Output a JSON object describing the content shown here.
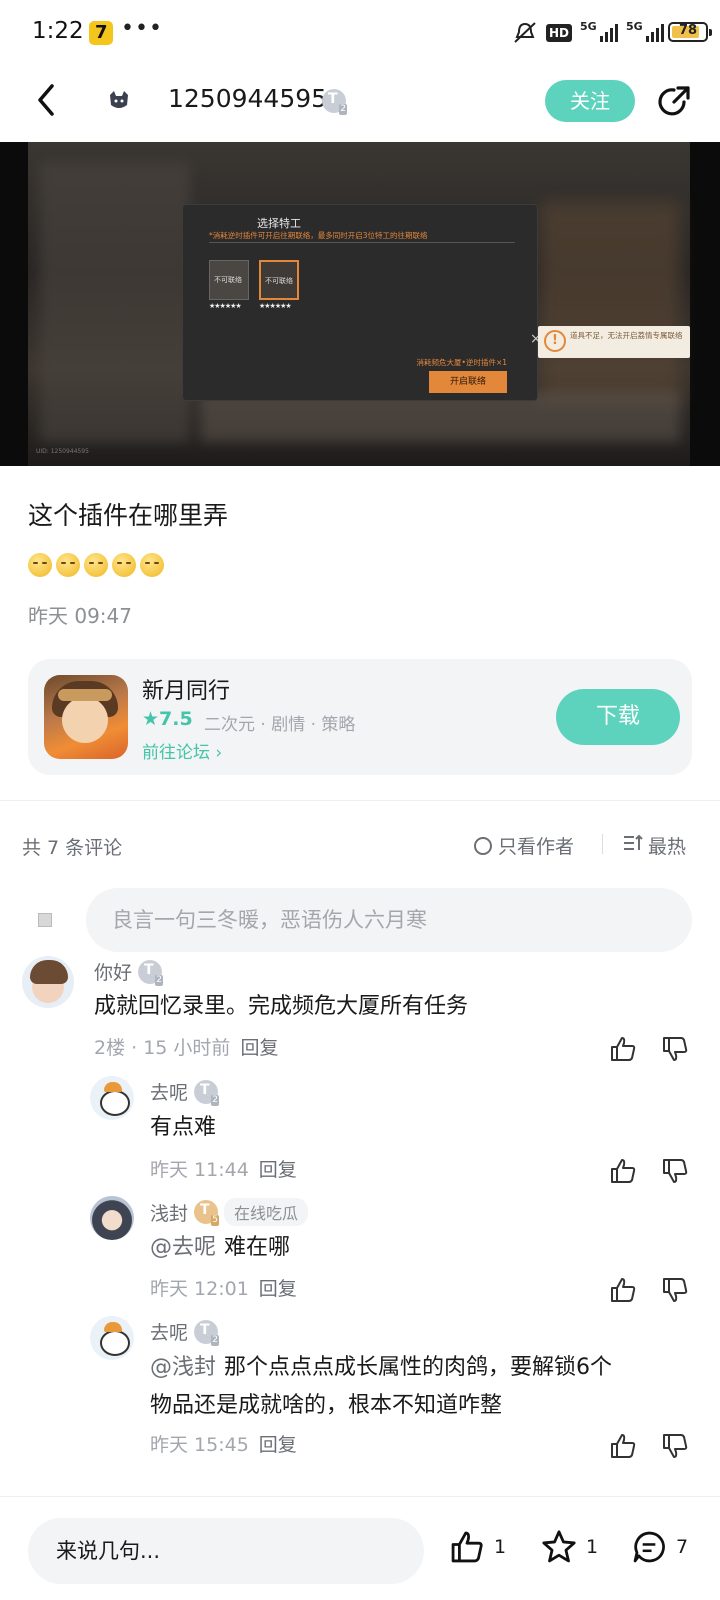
{
  "status": {
    "time": "1:22",
    "dots": "•••",
    "hd": "HD",
    "net1": "5G",
    "net2": "5G",
    "battery": "78"
  },
  "header": {
    "username": "1250944595",
    "follow_label": "关注"
  },
  "screenshot": {
    "dialog_title": "选择特工",
    "dialog_sub": "*消耗逆时插件可开启往期联络，最多同时开启3位特工的往期联络",
    "card_label_1": "不可联络",
    "card_label_2": "不可联络",
    "stars": "★★★★★★",
    "cost_text": "消耗频危大厦•逆时插件×1",
    "open_button": "开启联络",
    "toast_text": "道具不足，无法开启荔情专属联络",
    "toast_icon": "!",
    "uid": "UID: 1250944595"
  },
  "post": {
    "title": "这个插件在哪里弄",
    "time": "昨天 09:47",
    "emoji_count": 5
  },
  "game": {
    "name": "新月同行",
    "rating": "★7.5",
    "tags": "二次元 · 剧情 · 策略",
    "forum_link": "前往论坛 ›",
    "download_label": "下载"
  },
  "comments_header": {
    "count_label": "共 7 条评论",
    "author_only_label": "只看作者",
    "sort_label": "最热"
  },
  "comment_input": {
    "placeholder": "良言一句三冬暖，恶语伤人六月寒"
  },
  "comments": [
    {
      "name": "你好",
      "level": "2",
      "text": "成就回忆录里。完成频危大厦所有任务",
      "meta": "2楼 · 15 小时前",
      "reply": "回复"
    },
    {
      "name": "去呢",
      "level": "2",
      "text": "有点难",
      "meta": "昨天 11:44",
      "reply": "回复"
    },
    {
      "name": "浅封",
      "level": "5",
      "tag": "在线吃瓜",
      "mention": "@去呢",
      "text": "难在哪",
      "meta": "昨天 12:01",
      "reply": "回复"
    },
    {
      "name": "去呢",
      "level": "2",
      "mention": "@浅封",
      "text": "那个点点点成长属性的肉鸽，要解锁6个",
      "text2": "物品还是成就啥的，根本不知道咋整",
      "meta": "昨天 15:45",
      "reply": "回复"
    }
  ],
  "bottom": {
    "input_label": "来说几句...",
    "like_count": "1",
    "star_count": "1",
    "comment_count": "7"
  },
  "colors": {
    "accent": "#5dd3bd",
    "accent_text": "#44c4a8",
    "game_orange": "#e3873b"
  }
}
